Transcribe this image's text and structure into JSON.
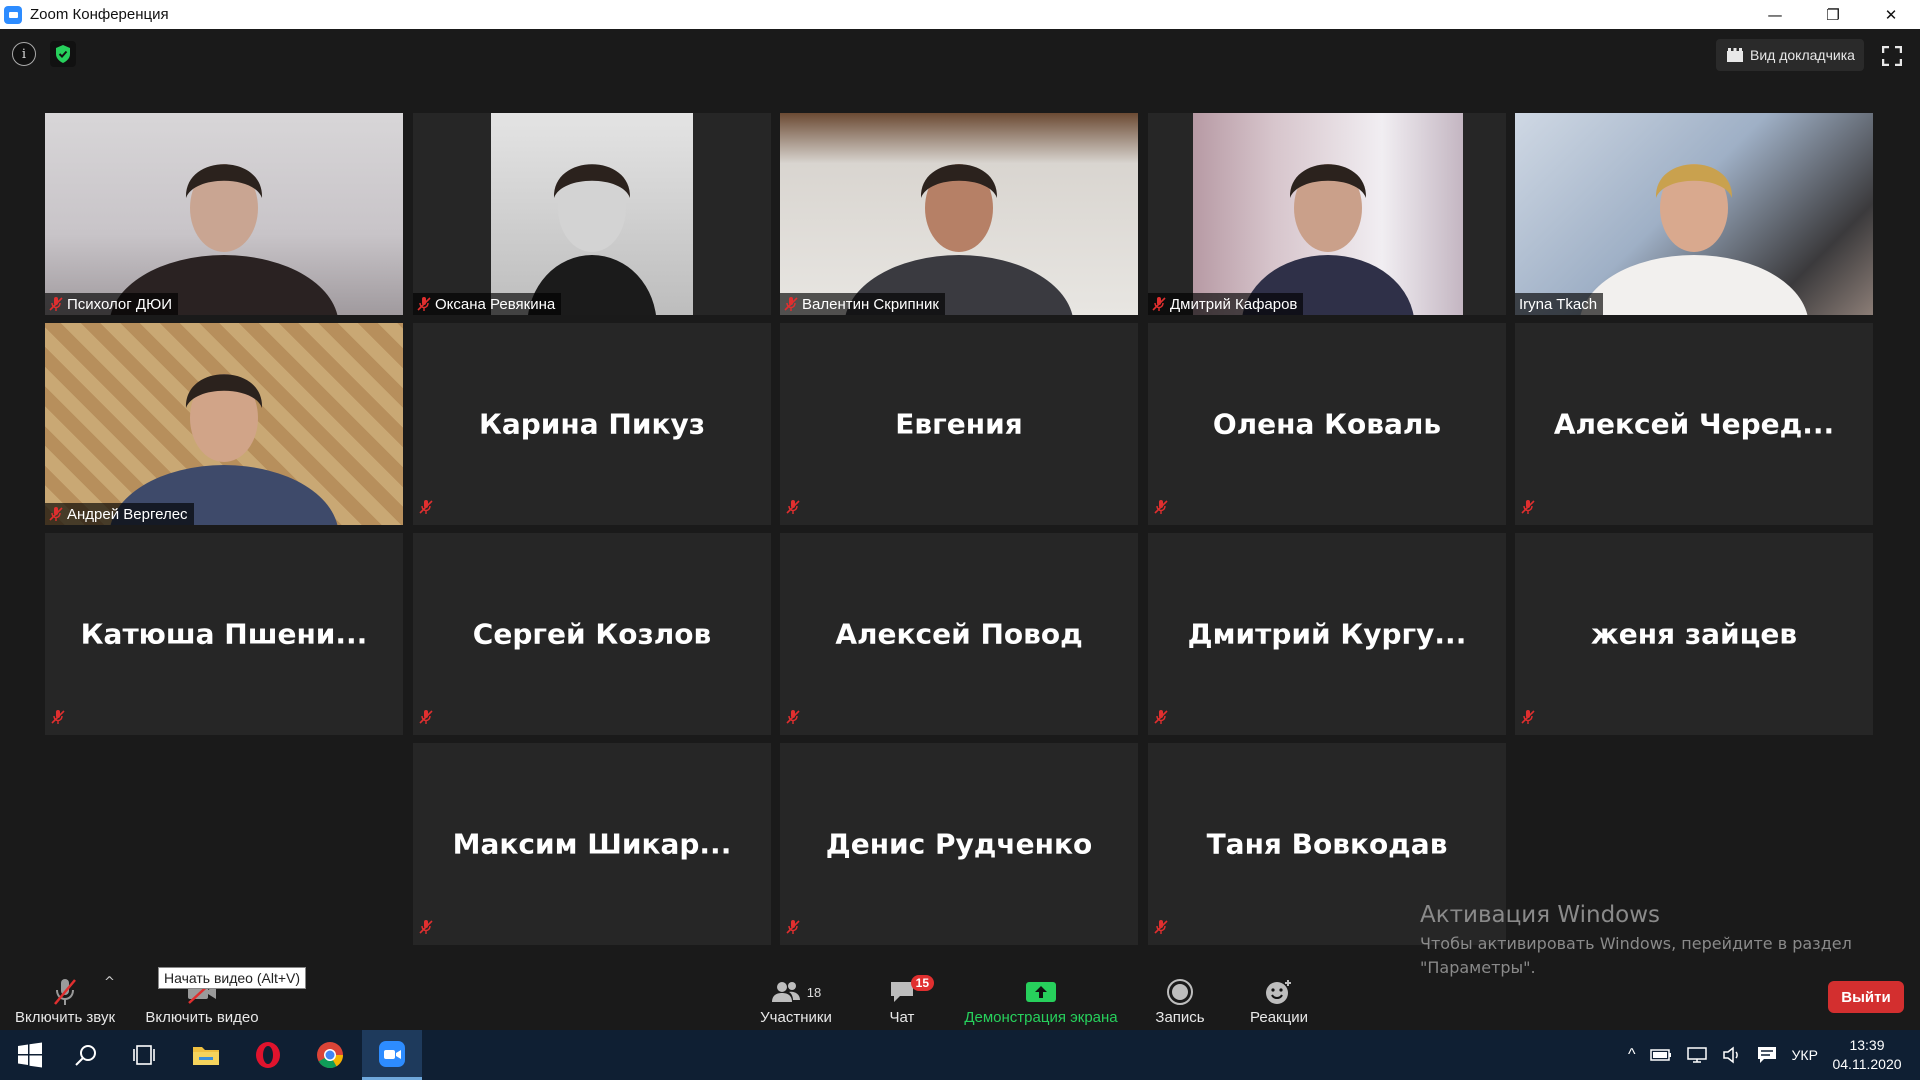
{
  "window": {
    "title": "Zoom Конференция",
    "controls": [
      "—",
      "❐",
      "✕"
    ]
  },
  "topbar": {
    "speaker_view_label": "Вид докладчика"
  },
  "participants": [
    {
      "name": "Психолог ДЮИ",
      "video": true
    },
    {
      "name": "Оксана Ревякина",
      "video": true
    },
    {
      "name": "Валентин Скрипник",
      "video": true
    },
    {
      "name": "Дмитрий Кафаров",
      "video": true
    },
    {
      "name": "Iryna Tkach",
      "video": true,
      "active": true
    },
    {
      "name": "Андрей Вергелес",
      "video": true
    },
    {
      "name": "Карина Пикуз",
      "video": false
    },
    {
      "name": "Евгения",
      "video": false
    },
    {
      "name": "Олена Коваль",
      "video": false
    },
    {
      "name": "Алексей  Черед...",
      "video": false
    },
    {
      "name": "Катюша  Пшени...",
      "video": false
    },
    {
      "name": "Сергей Козлов",
      "video": false
    },
    {
      "name": "Алексей Повод",
      "video": false
    },
    {
      "name": "Дмитрий  Кургу...",
      "video": false
    },
    {
      "name": "женя зайцев",
      "video": false
    },
    {
      "name": "Максим  Шикар...",
      "video": false
    },
    {
      "name": "Денис Рудченко",
      "video": false
    },
    {
      "name": "Таня Вовкодав",
      "video": false
    }
  ],
  "toolbar": {
    "unmute_label": "Включить звук",
    "start_video_label": "Включить видео",
    "start_video_tooltip": "Начать видео (Alt+V)",
    "participants_label": "Участники",
    "participants_count": "18",
    "chat_label": "Чат",
    "chat_badge": "15",
    "share_label": "Демонстрация экрана",
    "record_label": "Запись",
    "reactions_label": "Реакции",
    "leave_label": "Выйти"
  },
  "activation": {
    "heading": "Активация Windows",
    "text": "Чтобы активировать Windows, перейдите в раздел \"Параметры\"."
  },
  "taskbar": {
    "language": "УКР",
    "time": "13:39",
    "date": "04.11.2020"
  },
  "colors": {
    "active_speaker": "#d6f07a",
    "share_green": "#27d05c",
    "leave_red": "#d32f2f",
    "chat_badge": "#e02f2f"
  }
}
